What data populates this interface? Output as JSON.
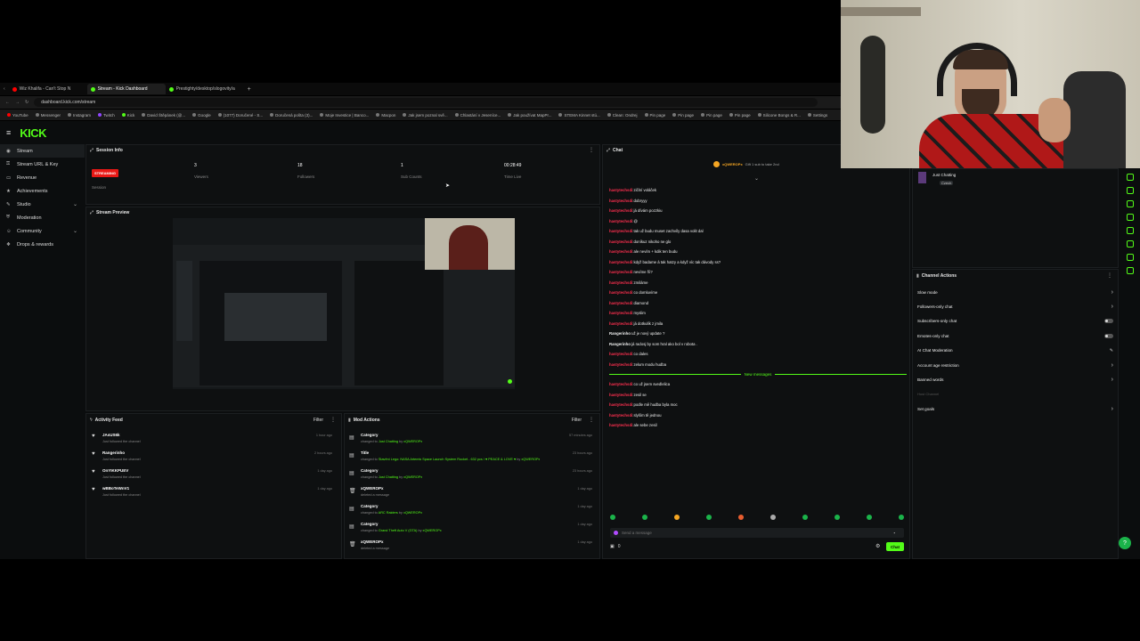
{
  "browser": {
    "tabs": [
      {
        "label": "Wiz Khalifa - Can't Stop N",
        "color": "#ff0000",
        "active": false
      },
      {
        "label": "Stream - Kick Dashboard",
        "color": "#53fc18",
        "active": true
      },
      {
        "label": "Prestighty/desktop/slogovity/a",
        "color": "#53fc18",
        "active": false
      }
    ],
    "new_tab_label": "+",
    "url": "dashboard.kick.com/stream",
    "bookmarks": [
      "YouTube",
      "Messenger",
      "Instagram",
      "Twitch",
      "Kick",
      "David Štěpánek (@...",
      "Google",
      "(1077) Doručené - S...",
      "Doručená pošta (3)...",
      "Moje Investice | Banco...",
      "Macpon",
      "Jak jsem poznal svě...",
      "Chlastání v Jeseníce...",
      "Jak používat MapPr...",
      "STEMA Kinnet stú...",
      "Clean: Ondrej",
      "Pin page",
      "Pin page",
      "Pin page",
      "Pin page",
      "Silicone Bongs & R...",
      "Settings"
    ]
  },
  "sidebar": {
    "items": [
      {
        "label": "Stream",
        "active": true,
        "expand": false
      },
      {
        "label": "Stream URL & Key",
        "active": false,
        "expand": false
      },
      {
        "label": "Revenue",
        "active": false,
        "expand": false
      },
      {
        "label": "Achievements",
        "active": false,
        "expand": false
      },
      {
        "label": "Studio",
        "active": false,
        "expand": true
      },
      {
        "label": "Moderation",
        "active": false,
        "expand": false
      },
      {
        "label": "Community",
        "active": false,
        "expand": true
      },
      {
        "label": "Drops & rewards",
        "active": false,
        "expand": false
      }
    ]
  },
  "session": {
    "title": "Session Info",
    "status_badge": "STREAMING",
    "status_label": "Session",
    "stats": [
      {
        "value": "3",
        "label": "Viewers"
      },
      {
        "value": "18",
        "label": "Followers"
      },
      {
        "value": "1",
        "label": "Sub Counts"
      },
      {
        "value": "00:28:49",
        "label": "Time Live"
      }
    ]
  },
  "preview": {
    "title": "Stream Preview"
  },
  "activity": {
    "title": "Activity Feed",
    "filter_label": "Filter",
    "items": [
      {
        "name": "JAsUS6k",
        "sub": "Just followed the channel",
        "time": "1 hour ago"
      },
      {
        "name": "Rangerinho",
        "sub": "Just followed the channel",
        "time": "2 hours ago"
      },
      {
        "name": "OnYIKKPUEV",
        "sub": "Just followed the channel",
        "time": "1 day ago"
      },
      {
        "name": "wBBoTeWnV1",
        "sub": "Just followed the channel",
        "time": "1 day ago"
      }
    ]
  },
  "mod_actions": {
    "title": "Mod Actions",
    "filter_label": "Filter",
    "items": [
      {
        "kind": "Category",
        "desc": "changed to",
        "value": "Just Chatting",
        "by": "by",
        "user": "xQWEROPx",
        "time": "57 minutes ago"
      },
      {
        "kind": "Title",
        "desc": "changed to",
        "value": "Stavění Lego: NASA Artemis Space Launch System Rocket - 632 pcs / ♥ PEACE & LOVE ♥",
        "by": "by",
        "user": "xQWEROPx",
        "time": "23 hours ago"
      },
      {
        "kind": "Category",
        "desc": "changed to",
        "value": "Just Chatting",
        "by": "by",
        "user": "xQWEROPx",
        "time": "23 hours ago"
      },
      {
        "kind": "xQWEROPx",
        "desc": "deleted a message",
        "value": "",
        "by": "",
        "user": "",
        "time": "1 day ago"
      },
      {
        "kind": "Category",
        "desc": "changed to",
        "value": "ARC Raiders",
        "by": "by",
        "user": "xQWEROPx",
        "time": "1 day ago"
      },
      {
        "kind": "Category",
        "desc": "changed to",
        "value": "Grand Theft Auto V (GTA)",
        "by": "by",
        "user": "xQWEROPx",
        "time": "1 day ago"
      },
      {
        "kind": "xQWEROPx",
        "desc": "deleted a message",
        "value": "",
        "by": "",
        "user": "",
        "time": "1 day ago"
      }
    ]
  },
  "chat": {
    "title": "Chat",
    "pinned_user": "xQWEROPx",
    "pinned_text": "Gift 1 sub to take 2nd",
    "messages": [
      {
        "user": "hastytechsdi",
        "text": "zičlní voláček"
      },
      {
        "user": "hastytechsdi",
        "text": "dobryyy"
      },
      {
        "user": "hastytechsdi",
        "text": "já dívám pozzkiu"
      },
      {
        "user": "hastytechsdi",
        "text": "@"
      },
      {
        "user": "hastytechsdi",
        "text": "tak už budu muset zachvíly dasa volit dal"
      },
      {
        "user": "hastytechsdi",
        "text": "doníkuz nikoho ne glo"
      },
      {
        "user": "hastytechsdi",
        "text": "ale nevím + kdik ten budu"
      },
      {
        "user": "hastytechsdi",
        "text": "když badame á tak hatzy a když víc tak dávody ss?"
      },
      {
        "user": "hastytechsdi",
        "text": "nevíme říi?"
      },
      {
        "user": "hastytechsdi",
        "text": "zmiláme"
      },
      {
        "user": "hastytechsdi",
        "text": "co domluvíme"
      },
      {
        "user": "hastytechsdi",
        "text": "diamond"
      },
      {
        "user": "hastytechsdi",
        "text": "myslim"
      },
      {
        "user": "hastytechsdi",
        "text": "já dotkulík z jmila"
      },
      {
        "user": "Rangerinho",
        "text": "už je nový update ?"
      },
      {
        "user": "Rangerinho",
        "text": "já radosj by som hral ako bol v robota ."
      },
      {
        "user": "hastytechsdi",
        "text": "co dales"
      },
      {
        "user": "hastytechsdi",
        "text": "zelum modu hudba"
      }
    ],
    "new_messages_label": "New messages",
    "new_messages": [
      {
        "user": "hastytechsdi",
        "text": "co už jsem svedlelica"
      },
      {
        "user": "hastytechsdi",
        "text": "zesil se"
      },
      {
        "user": "hastytechsdi",
        "text": "podle mě hudba byla moc"
      },
      {
        "user": "hastytechsdi",
        "text": "slyším tě jednou"
      },
      {
        "user": "hastytechsdi",
        "text": "ale sebe zesil"
      }
    ],
    "input_placeholder": "Send a message",
    "viewer_count": "0",
    "send_label": "Chat"
  },
  "category": {
    "name": "Just Chatting",
    "lang": "Czech"
  },
  "channel_actions": {
    "title": "Channel Actions",
    "items": [
      {
        "label": "Slow mode",
        "control": "chevron"
      },
      {
        "label": "Followers-only chat",
        "control": "chevron"
      },
      {
        "label": "Subscribers-only chat",
        "control": "toggle"
      },
      {
        "label": "Emotes-only chat",
        "control": "toggle"
      },
      {
        "label": "AI Chat Moderation",
        "control": "edit"
      },
      {
        "label": "Account age restriction",
        "control": "chevron"
      },
      {
        "label": "Banned words",
        "control": "chevron"
      },
      {
        "label": "Host Channel",
        "control": "none"
      },
      {
        "label": "Set goals",
        "control": "chevron"
      }
    ]
  },
  "colors": {
    "brand": "#53fc18",
    "live": "#e91916",
    "chat_user": "#ff2f4f"
  }
}
